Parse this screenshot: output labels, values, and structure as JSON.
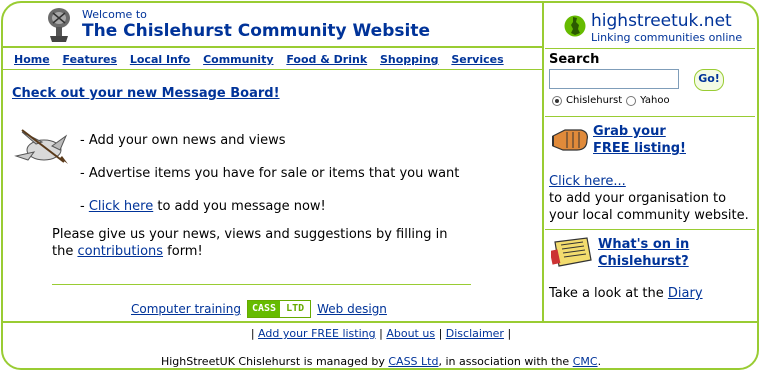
{
  "header": {
    "welcome": "Welcome to",
    "title": "The Chislehurst Community Website"
  },
  "nav": {
    "items": [
      "Home",
      "Features",
      "Local Info",
      "Community",
      "Food & Drink",
      "Shopping",
      "Services"
    ]
  },
  "main": {
    "headline": "Check out your new Message Board!",
    "bullet1": "- Add your own news and views",
    "bullet2": "- Advertise items you have for sale or items that you want",
    "bullet3_prefix": "- ",
    "bullet3_link": "Click here",
    "bullet3_suffix": " to add you message now!",
    "para_line1": "Please give us your news, views and suggestions by filling in",
    "para_prefix": "the ",
    "para_link": "contributions",
    "para_suffix": " form!"
  },
  "sponsor": {
    "left_link": "Computer training",
    "logo_part1": "CASS",
    "logo_part2": "LTD",
    "right_link": "Web design"
  },
  "footer": {
    "sep": "|",
    "link1": "Add your FREE listing",
    "link2": "About us",
    "link3": "Disclaimer",
    "text_prefix": "HighStreetUK Chislehurst is managed by ",
    "text_link1": "CASS Ltd",
    "text_middle": ", in association with the ",
    "text_link2": "CMC",
    "text_suffix": "."
  },
  "brand": {
    "name": "highstreetuk.net",
    "tagline": "Linking communities online"
  },
  "search": {
    "title": "Search",
    "input_value": "",
    "go_label": "Go!",
    "option1": "Chislehurst",
    "option2": "Yahoo",
    "selected": "Chislehurst"
  },
  "sidebar": {
    "grab_line1": "Grab your",
    "grab_line2": "FREE listing!",
    "click_here": "Click here...",
    "org_text": "to add your organisation to your local community website.",
    "whatson_line1": "What's on in",
    "whatson_line2": "Chislehurst?",
    "diary_prefix": "Take a look at the ",
    "diary_link": "Diary"
  },
  "colors": {
    "accent_green": "#99cc33",
    "link_blue": "#003399"
  }
}
